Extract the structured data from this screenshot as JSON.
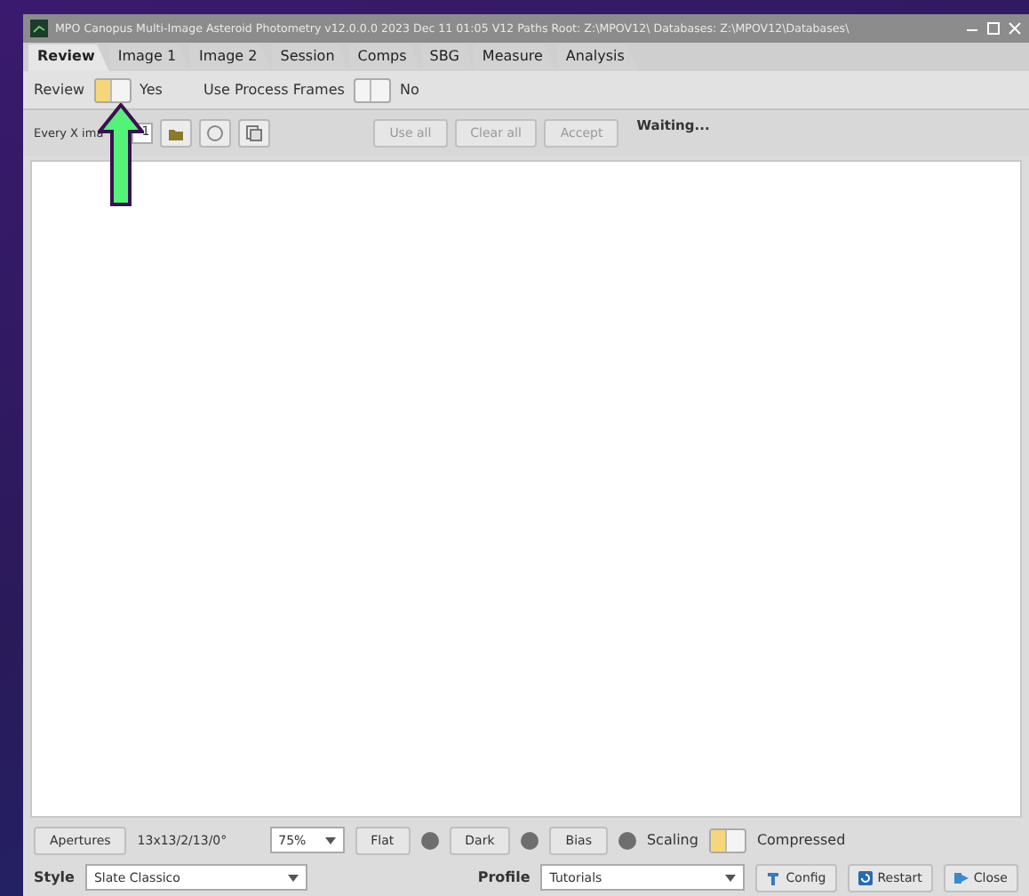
{
  "window": {
    "title": "MPO Canopus Multi-Image Asteroid Photometry   v12.0.0.0  2023 Dec 11  01:05      V12 Paths  Root: Z:\\MPOV12\\    Databases: Z:\\MPOV12\\Databases\\"
  },
  "tabs": [
    {
      "label": "Review",
      "selected": true
    },
    {
      "label": "Image 1",
      "selected": false
    },
    {
      "label": "Image 2",
      "selected": false
    },
    {
      "label": "Session",
      "selected": false
    },
    {
      "label": "Comps",
      "selected": false
    },
    {
      "label": "SBG",
      "selected": false
    },
    {
      "label": "Measure",
      "selected": false
    },
    {
      "label": "Analysis",
      "selected": false
    }
  ],
  "options": [
    {
      "label": "Review",
      "on": true,
      "state_text": "Yes"
    },
    {
      "label": "Use Process Frames",
      "on": false,
      "state_text": "No"
    }
  ],
  "toolbar": {
    "every_label": "Every X ima",
    "every_value": "1",
    "icons": [
      {
        "kind": "folder"
      },
      {
        "kind": "circle"
      },
      {
        "kind": "copy"
      }
    ],
    "buttons": [
      {
        "label": "Use all",
        "disabled": true
      },
      {
        "label": "Clear all",
        "disabled": true
      },
      {
        "label": "Accept",
        "disabled": true
      }
    ],
    "status": "Waiting..."
  },
  "bottom": {
    "apertures_button": "Apertures",
    "aperture_text": "13x13/2/13/0°",
    "zoom": "75%",
    "calibration": [
      {
        "label": "Flat"
      },
      {
        "label": "Dark"
      },
      {
        "label": "Bias"
      }
    ],
    "scaling": {
      "label": "Scaling",
      "on": true,
      "state_text": "Compressed"
    },
    "style_label": "Style",
    "style_value": "Slate Classico",
    "profile_label": "Profile",
    "profile_value": "Tutorials",
    "buttons": [
      {
        "label": "Config",
        "kind": "config"
      },
      {
        "label": "Restart",
        "kind": "restart"
      },
      {
        "label": "Close",
        "kind": "close"
      }
    ]
  }
}
